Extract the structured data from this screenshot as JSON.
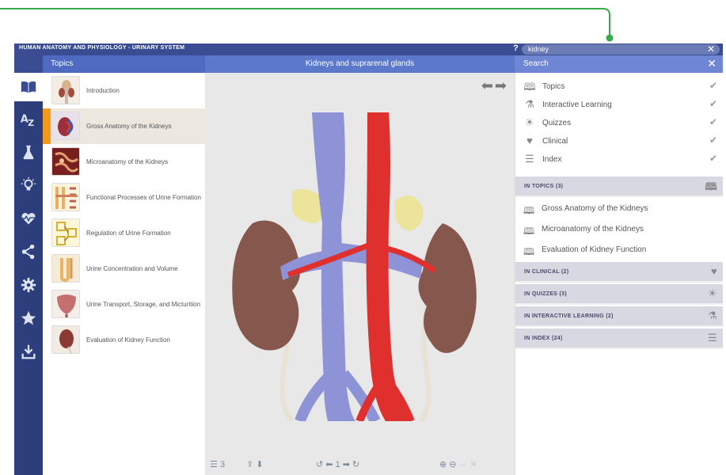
{
  "app": {
    "title": "HUMAN ANATOMY AND PHYSIOLOGY - URINARY SYSTEM",
    "help": "?",
    "search_value": "kidney",
    "search_clear": "✕"
  },
  "header": {
    "topics_label": "Topics",
    "view_title": "Kidneys and suprarenal glands",
    "search_label": "Search",
    "search_close": "✕"
  },
  "sidebar": {
    "icons": [
      "book-icon",
      "az-icon",
      "flask-icon",
      "lightbulb-icon",
      "heartbeat-icon",
      "share-icon",
      "gear-icon",
      "star-icon",
      "download-icon"
    ]
  },
  "topics": [
    {
      "label": "Introduction"
    },
    {
      "label": "Gross Anatomy of the Kidneys",
      "active": true
    },
    {
      "label": "Microanatomy of the Kidneys"
    },
    {
      "label": "Functional Processes of Urine Formation"
    },
    {
      "label": "Regulation of Urine Formation"
    },
    {
      "label": "Urine Concentration and Volume"
    },
    {
      "label": "Urine Transport, Storage, and Micturition"
    },
    {
      "label": "Evaluation of Kidney Function"
    }
  ],
  "viewer": {
    "layers_count": "3",
    "page": "1"
  },
  "filters": [
    {
      "label": "Topics",
      "icon": "book-icon",
      "checked": true
    },
    {
      "label": "Interactive Learning",
      "icon": "flask-icon",
      "checked": true
    },
    {
      "label": "Quizzes",
      "icon": "lightbulb-icon",
      "checked": true
    },
    {
      "label": "Clinical",
      "icon": "heartbeat-icon",
      "checked": true
    },
    {
      "label": "Index",
      "icon": "list-icon",
      "checked": true
    }
  ],
  "results": {
    "in_topics": "IN TOPICS (3)",
    "topic_hits": [
      "Gross Anatomy of the Kidneys",
      "Microanatomy of the Kidneys",
      "Evaluation of Kidney Function"
    ],
    "in_clinical": "IN CLINICAL (2)",
    "in_quizzes": "IN QUIZZES (3)",
    "in_interactive": "IN INTERACTIVE LEARNING (2)",
    "in_index": "IN INDEX (24)"
  },
  "colors": {
    "titlebar": "#3a4d92",
    "sidebar": "#2c3f7c",
    "accent": "#f29a1a",
    "callout": "#3aa94a"
  }
}
